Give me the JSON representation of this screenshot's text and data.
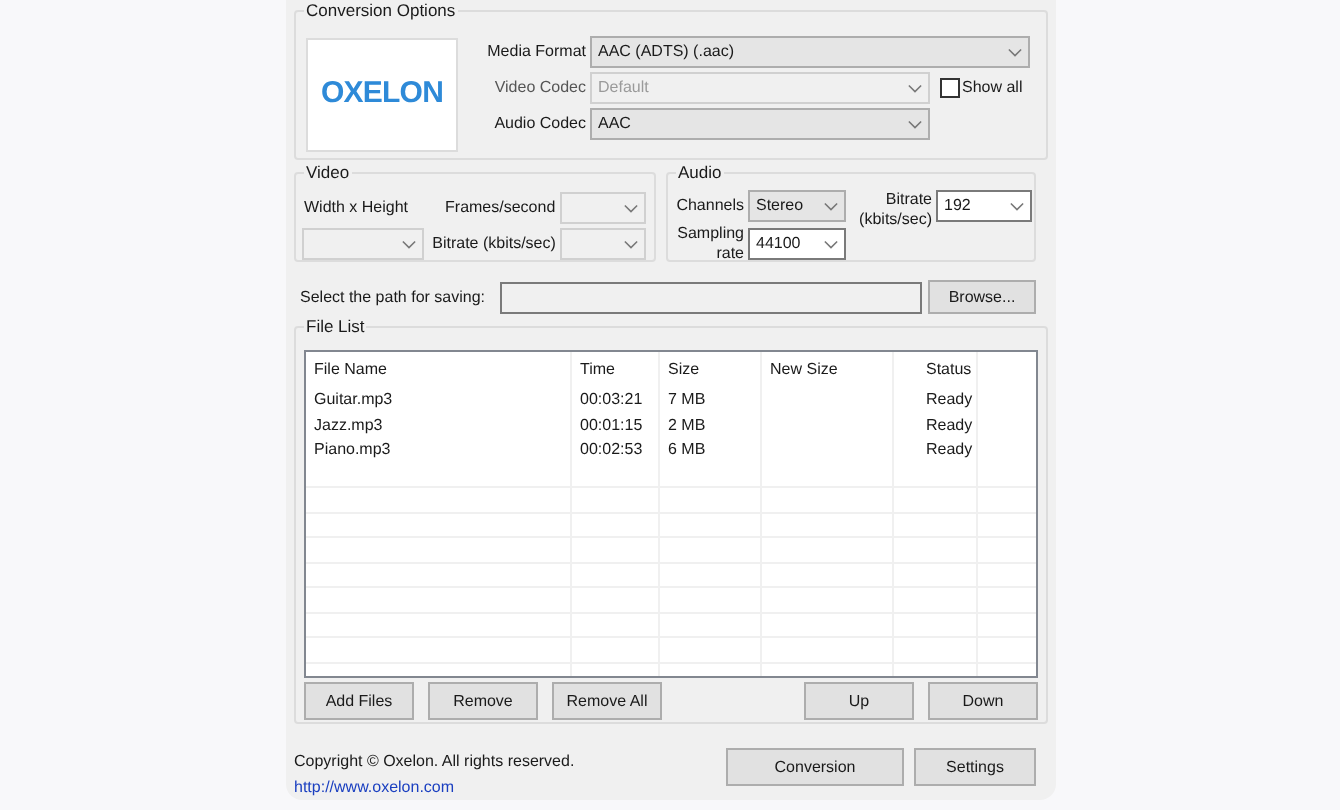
{
  "conversion_options": {
    "title": "Conversion Options",
    "logo": "OXELON",
    "media_format": {
      "label": "Media Format",
      "value": "AAC (ADTS) (.aac)",
      "kind": "list",
      "disabled": false
    },
    "video_codec": {
      "label": "Video Codec",
      "value": "Default",
      "disabled": true
    },
    "show_all": {
      "label": "Show all",
      "checked": false
    },
    "audio_codec": {
      "label": "Audio Codec",
      "value": "AAC",
      "kind": "list",
      "disabled": false
    }
  },
  "video": {
    "title": "Video",
    "width_height": {
      "label": "Width x Height",
      "disabled": true
    },
    "frames_per_second": {
      "label": "Frames/second",
      "disabled": true
    },
    "bitrate": {
      "label": "Bitrate (kbits/sec)",
      "disabled": true
    }
  },
  "audio": {
    "title": "Audio",
    "channels": {
      "label": "Channels",
      "value": "Stereo",
      "kind": "list",
      "disabled": false
    },
    "sampling_rate": {
      "label": "Sampling rate",
      "value": "44100",
      "kind": "edit",
      "disabled": false
    },
    "bitrate": {
      "label": "Bitrate (kbits/sec)",
      "value": "192",
      "kind": "edit",
      "disabled": false
    }
  },
  "save_path": {
    "label": "Select the path for saving:",
    "button": "Browse..."
  },
  "file_list": {
    "title": "File List",
    "columns": [
      "File Name",
      "Time",
      "Size",
      "New Size",
      "Status"
    ],
    "rows": [
      [
        "Guitar.mp3",
        "00:03:21",
        "7 MB",
        "",
        "Ready"
      ],
      [
        "Jazz.mp3",
        "00:01:15",
        "2 MB",
        "",
        "Ready"
      ],
      [
        "Piano.mp3",
        "00:02:53",
        "6 MB",
        "",
        "Ready"
      ]
    ]
  },
  "list_buttons": [
    "Add Files",
    "Remove",
    "Remove All",
    "Up",
    "Down"
  ],
  "copyright": "Copyright © Oxelon. All rights reserved.",
  "link": "http://www.oxelon.com",
  "footer_buttons": [
    "Conversion",
    "Settings"
  ]
}
